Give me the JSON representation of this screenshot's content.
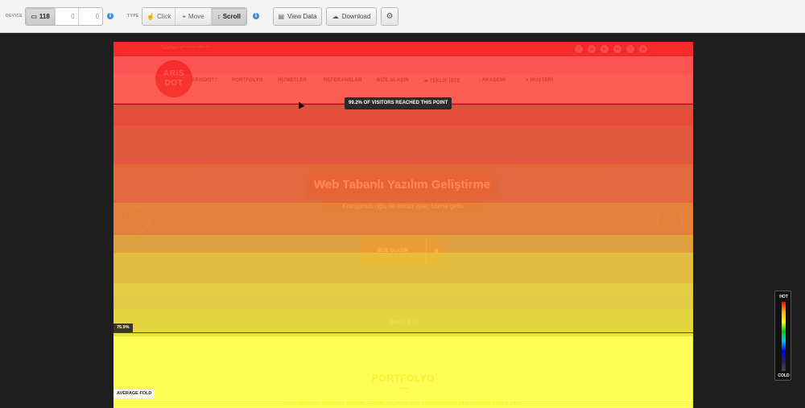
{
  "toolbar": {
    "device_label": "DEVICE",
    "device_counts": [
      "118",
      "0",
      "0"
    ],
    "type_label": "TYPE",
    "modes": [
      "Click",
      "Move",
      "Scroll"
    ],
    "view_data": "View Data",
    "download": "Download",
    "info_glyph": "i"
  },
  "site": {
    "phone": "Telefon: +** ** ** **** **",
    "social": [
      "f",
      "◎",
      "▶",
      "in",
      "t",
      "◉"
    ],
    "logo_line1": "ARIS",
    "logo_line2": "DOT",
    "nav": [
      "ARISDOT?",
      "PORTFOLYO",
      "HİZMETLER",
      "REFERANSLAR",
      "BİZE ULAŞIN",
      "TEKLİF İSTE",
      "AKADEMİ",
      "MÜŞTERİ"
    ],
    "hero_title": "Web Tabanlı Yazılım Geliştirme",
    "hero_subtitle": "Komşunun oğlu ile olmaz işler, bilene gelin",
    "hero_button": "BİZE ULAŞIN",
    "section_title": "PORTFOLYO",
    "section_text": "Deha kimsenin tekelinde değildir. Aksine birçok insanın yeteneklerinin birleşmesiyle ortaya çıkar."
  },
  "heatmap": {
    "tooltip": "99.2% OF VISITORS REACHED THIS POINT",
    "marker_75": "75.9%",
    "average_fold": "AVERAGE FOLD",
    "legend_hot": "HOT",
    "legend_cold": "COLD",
    "bands": [
      {
        "color": "#ff2f2f",
        "opacity": 0.82
      },
      {
        "color": "#ff3a30",
        "opacity": 0.82
      },
      {
        "color": "#ff4632",
        "opacity": 0.8
      },
      {
        "color": "#ff5534",
        "opacity": 0.8
      },
      {
        "color": "#ff6a34",
        "opacity": 0.8
      },
      {
        "color": "#ff8a35",
        "opacity": 0.8
      },
      {
        "color": "#ffb03a",
        "opacity": 0.8
      },
      {
        "color": "#ffd23e",
        "opacity": 0.82
      },
      {
        "color": "#ffe640",
        "opacity": 0.82
      },
      {
        "color": "#fff23c",
        "opacity": 0.82
      },
      {
        "color": "#ffff3a",
        "opacity": 0.85
      }
    ]
  }
}
